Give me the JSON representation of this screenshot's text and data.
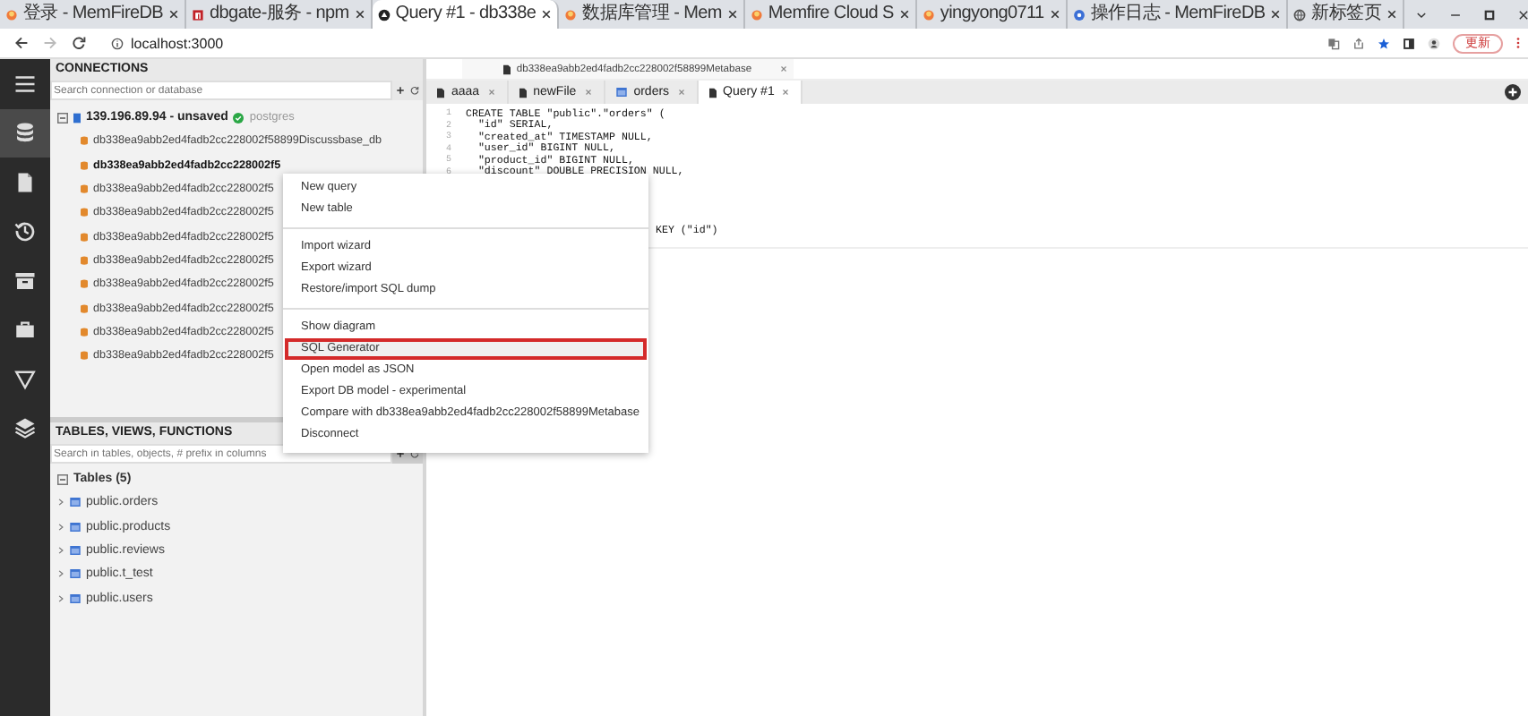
{
  "browser": {
    "tabs": [
      {
        "title": "登录 - MemFireDB",
        "selected": false
      },
      {
        "title": "dbgate-服务 - npm",
        "selected": false
      },
      {
        "title": "Query #1 - db338e",
        "selected": true
      },
      {
        "title": "数据库管理 - Mem",
        "selected": false
      },
      {
        "title": "Memfire Cloud S",
        "selected": false
      },
      {
        "title": "yingyong0711",
        "selected": false
      },
      {
        "title": "操作日志 - MemFireDB",
        "selected": false
      },
      {
        "title": "新标签页",
        "selected": false
      }
    ],
    "address": "localhost:3000",
    "update_button": "更新"
  },
  "sidebar": {
    "items": [
      {
        "selected": true
      },
      {
        "selected": false
      },
      {
        "selected": false
      },
      {
        "selected": false
      },
      {
        "selected": false
      },
      {
        "selected": false
      },
      {
        "selected": false
      }
    ]
  },
  "connections": {
    "title": "CONNECTIONS",
    "search_placeholder": "Search connection or database",
    "server": {
      "name": "139.196.89.94 - unsaved",
      "engine": "postgres",
      "expanded": true
    },
    "databases": [
      {
        "name": "db338ea9abb2ed4fadb2cc228002f58899Discussbase_db",
        "selected": false
      },
      {
        "name": "db338ea9abb2ed4fadb2cc228002f5",
        "selected": true
      },
      {
        "name": "db338ea9abb2ed4fadb2cc228002f5",
        "selected": false
      },
      {
        "name": "db338ea9abb2ed4fadb2cc228002f5",
        "selected": false
      },
      {
        "name": "db338ea9abb2ed4fadb2cc228002f5",
        "selected": false
      },
      {
        "name": "db338ea9abb2ed4fadb2cc228002f5",
        "selected": false
      },
      {
        "name": "db338ea9abb2ed4fadb2cc228002f5",
        "selected": false
      },
      {
        "name": "db338ea9abb2ed4fadb2cc228002f5",
        "selected": false
      },
      {
        "name": "db338ea9abb2ed4fadb2cc228002f5",
        "selected": false
      },
      {
        "name": "db338ea9abb2ed4fadb2cc228002f5",
        "selected": false
      }
    ]
  },
  "objects": {
    "title": "TABLES, VIEWS, FUNCTIONS",
    "search_placeholder": "Search in tables, objects, # prefix in columns",
    "group": {
      "label": "Tables (5)",
      "expanded": true
    },
    "tables": [
      {
        "name": "public.orders"
      },
      {
        "name": "public.products"
      },
      {
        "name": "public.reviews"
      },
      {
        "name": "public.t_test"
      },
      {
        "name": "public.users"
      }
    ]
  },
  "context_menu": {
    "groups": [
      [
        {
          "label": "New query",
          "selected": false
        },
        {
          "label": "New table",
          "selected": false
        }
      ],
      [
        {
          "label": "Import wizard",
          "selected": false
        },
        {
          "label": "Export wizard",
          "selected": false
        },
        {
          "label": "Restore/import SQL dump",
          "selected": false
        }
      ],
      [
        {
          "label": "Show diagram",
          "selected": false
        },
        {
          "label": "SQL Generator",
          "selected": true
        },
        {
          "label": "Open model as JSON",
          "selected": false
        },
        {
          "label": "Export DB model - experimental",
          "selected": false
        },
        {
          "label": "Compare with db338ea9abb2ed4fadb2cc228002f58899Metabase",
          "selected": false
        },
        {
          "label": "Disconnect",
          "selected": false
        }
      ]
    ]
  },
  "editor": {
    "database_tab": "db338ea9abb2ed4fadb2cc228002f58899Metabase",
    "tabs": [
      {
        "label": "aaaa",
        "kind": "file",
        "selected": false
      },
      {
        "label": "newFile",
        "kind": "file",
        "selected": false
      },
      {
        "label": "orders",
        "kind": "table",
        "selected": false
      },
      {
        "label": "Query #1",
        "kind": "file",
        "selected": true
      }
    ],
    "lines": [
      {
        "number": "1",
        "code": "CREATE TABLE \"public\".\"orders\" ("
      },
      {
        "number": "2",
        "code": "  \"id\" SERIAL,"
      },
      {
        "number": "3",
        "code": "  \"created_at\" TIMESTAMP NULL,"
      },
      {
        "number": "4",
        "code": "  \"user_id\" BIGINT NULL,"
      },
      {
        "number": "5",
        "code": "  \"product_id\" BIGINT NULL,"
      },
      {
        "number": "6",
        "code": "  \"discount\" DOUBLE PRECISION NULL,"
      },
      {
        "code": "KEY (\"id\")"
      }
    ]
  }
}
